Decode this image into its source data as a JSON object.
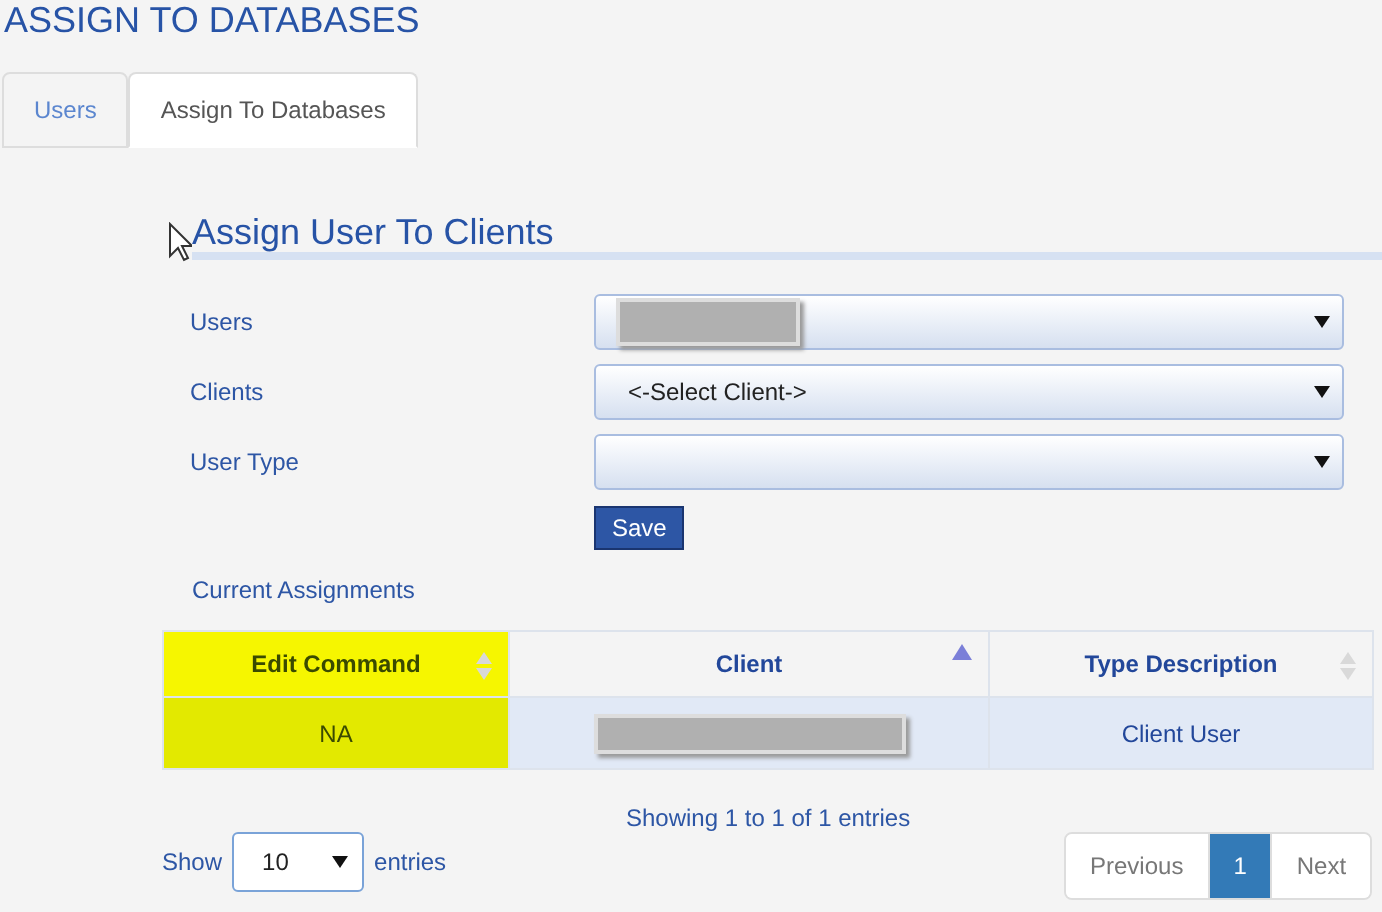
{
  "page_title": "ASSIGN TO DATABASES",
  "tabs": [
    {
      "label": "Users",
      "selected": false
    },
    {
      "label": "Assign To Databases",
      "selected": true
    }
  ],
  "section_title": "Assign User To Clients",
  "form": [
    {
      "label": "Users",
      "kind": "redacted"
    },
    {
      "label": "Clients",
      "kind": "text",
      "value": "<-Select Client->"
    },
    {
      "label": "User Type",
      "kind": "empty"
    }
  ],
  "save_button": "Save",
  "assignments_title": "Current Assignments",
  "table": {
    "columns": [
      {
        "label": "Edit Command",
        "sorted": false,
        "highlighted": true
      },
      {
        "label": "Client",
        "sorted": true,
        "highlighted": false
      },
      {
        "label": "Type Description",
        "sorted": false,
        "highlighted": false
      }
    ],
    "rows": [
      [
        {
          "kind": "text",
          "text": "NA"
        },
        {
          "kind": "redacted"
        },
        {
          "kind": "text",
          "text": "Client User"
        }
      ]
    ]
  },
  "info": "Showing 1 to 1 of 1 entries",
  "length": {
    "before": "Show",
    "value": "10",
    "after": "entries"
  },
  "pagination": [
    {
      "label": "Previous",
      "selected": false
    },
    {
      "label": "1",
      "selected": true
    },
    {
      "label": "Next",
      "selected": false
    }
  ]
}
